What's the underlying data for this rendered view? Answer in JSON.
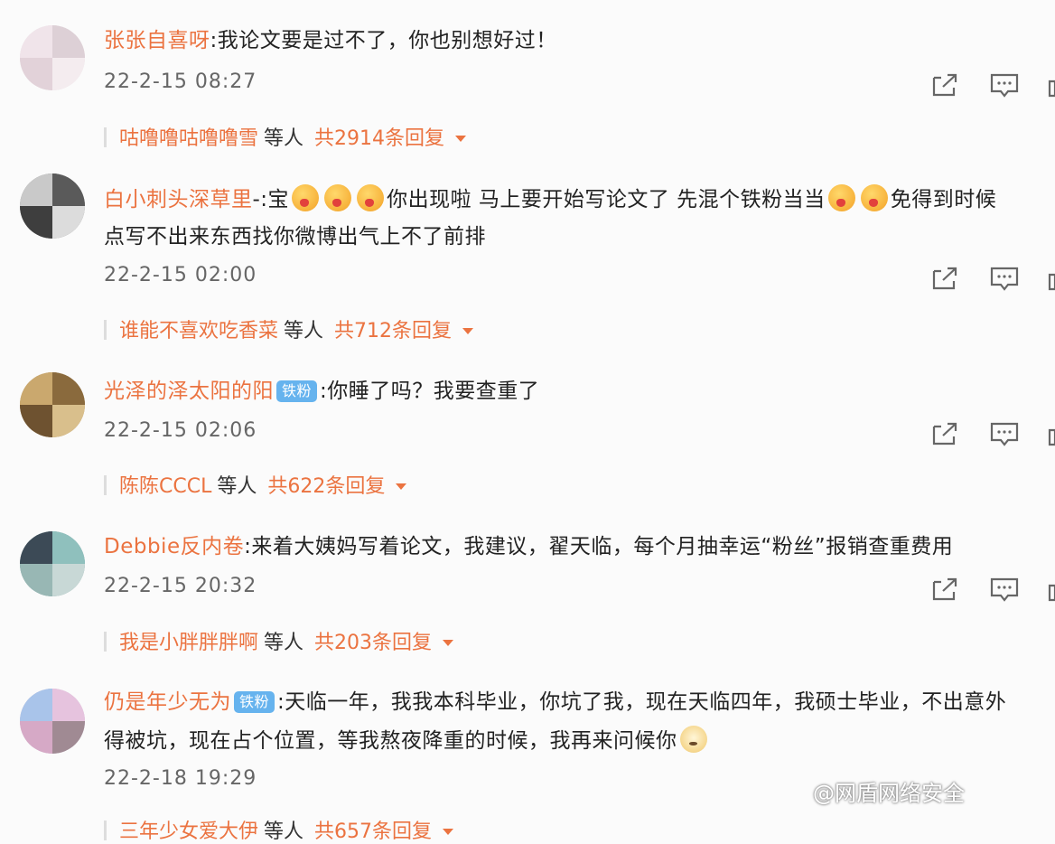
{
  "comments": [
    {
      "username": "张张自喜呀",
      "text": ":我论文要是过不了，你也别想好过！",
      "time": "22-2-15 08:27",
      "reply_user": "咕噜噜咕噜噜雪",
      "reply_etc": "等人",
      "reply_count": "共2914条回复"
    },
    {
      "username": "白小刺头深草里",
      "text_pre": "-:宝",
      "text_mid": "你出现啦 马上要开始写论文了 先混个铁粉当当",
      "text_tail": "免得到时候",
      "text_line2": "点写不出来东西找你微博出气上不了前排",
      "time": "22-2-15 02:00",
      "reply_user": "谁能不喜欢吃香菜",
      "reply_etc": "等人",
      "reply_count": "共712条回复"
    },
    {
      "username": "光泽的泽太阳的阳",
      "badge": "铁粉",
      "text": ":你睡了吗？我要查重了",
      "time": "22-2-15 02:06",
      "reply_user": "陈陈CCCL",
      "reply_etc": "等人",
      "reply_count": "共622条回复"
    },
    {
      "username": "Debbie反内卷",
      "text": ":来着大姨妈写着论文，我建议，翟天临，每个月抽幸运“粉丝”报销查重费用",
      "time": "22-2-15 20:32",
      "reply_user": "我是小胖胖胖啊",
      "reply_etc": "等人",
      "reply_count": "共203条回复"
    },
    {
      "username": "仍是年少无为",
      "badge": "铁粉",
      "text": ":天临一年，我我本科毕业，你坑了我，现在天临四年，我硕士毕业，不出意外",
      "text_line2": "得被坑，现在占个位置，等我熬夜降重的时候，我再来问候你",
      "time": "22-2-18 19:29",
      "reply_user": "三年少女爱大伊",
      "reply_etc": "等人",
      "reply_count": "共657条回复"
    }
  ],
  "watermark": "@网盾网络安全",
  "icons": {
    "share": "share-icon",
    "comment": "comment-icon",
    "like": "like-icon",
    "caret": "caret-down-icon",
    "emoji": "emoji-icon"
  },
  "colors": {
    "username": "#eb7340",
    "badge": "#66b3ee",
    "text": "#222222",
    "time": "#666666"
  }
}
